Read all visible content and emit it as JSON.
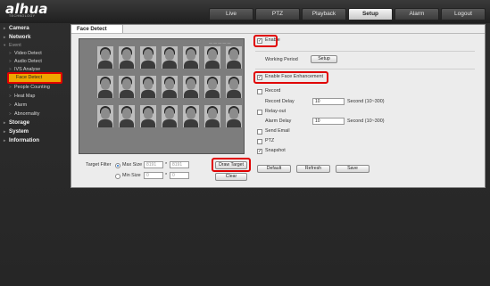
{
  "header": {
    "logo": "alhua",
    "logo_sub": "TECHNOLOGY",
    "tabs": [
      "Live",
      "PTZ",
      "Playback",
      "Setup",
      "Alarm",
      "Logout"
    ],
    "active_tab": "Setup"
  },
  "sidebar": {
    "items": [
      {
        "label": "Camera"
      },
      {
        "label": "Network"
      },
      {
        "label": "Event"
      },
      {
        "label": "Video Detect"
      },
      {
        "label": "Audio Detect"
      },
      {
        "label": "IVS Analyse"
      },
      {
        "label": "Face Detect"
      },
      {
        "label": "People Counting"
      },
      {
        "label": "Heat Map"
      },
      {
        "label": "Alarm"
      },
      {
        "label": "Abnormality"
      },
      {
        "label": "Storage"
      },
      {
        "label": "System"
      },
      {
        "label": "Information"
      }
    ]
  },
  "panel": {
    "tab": "Face Detect",
    "enable": {
      "label": "Enable",
      "checked": true
    },
    "working_period": {
      "label": "Working Period",
      "button": "Setup"
    },
    "face_enhancement": {
      "label": "Enable Face Enhancement",
      "checked": true
    },
    "record": {
      "label": "Record",
      "checked": false
    },
    "record_delay": {
      "label": "Record Delay",
      "value": "10",
      "unit": "Second (10~300)"
    },
    "relay_out": {
      "label": "Relay-out",
      "checked": false
    },
    "alarm_delay": {
      "label": "Alarm Delay",
      "value": "10",
      "unit": "Second (10~300)"
    },
    "send_email": {
      "label": "Send Email",
      "checked": false
    },
    "ptz": {
      "label": "PTZ",
      "checked": false
    },
    "snapshot": {
      "label": "Snapshot",
      "checked": true
    },
    "buttons": {
      "default": "Default",
      "refresh": "Refresh",
      "save": "Save"
    },
    "target_filter": {
      "label": "Target Filter",
      "max_size": {
        "label": "Max Size",
        "w": "8191",
        "sep": "*",
        "h": "8191",
        "selected": true
      },
      "min_size": {
        "label": "Min Size",
        "w": "0",
        "sep": "*",
        "h": "0",
        "selected": false
      }
    },
    "draw_target": "Draw Target",
    "clear": "Clear"
  }
}
